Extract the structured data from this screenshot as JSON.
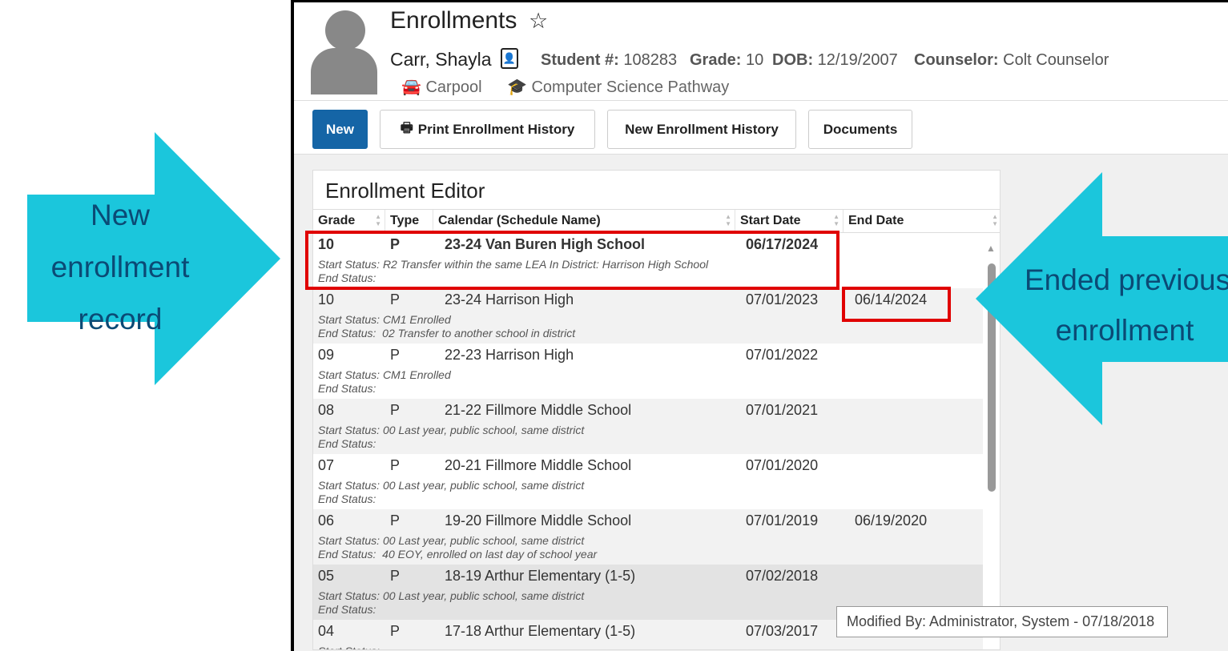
{
  "header": {
    "title": "Enrollments",
    "student_name": "Carr, Shayla",
    "student_num_label": "Student #:",
    "student_num": "108283",
    "grade_label": "Grade:",
    "grade": "10",
    "dob_label": "DOB:",
    "dob": "12/19/2007",
    "counselor_label": "Counselor:",
    "counselor": "Colt Counselor",
    "tags": [
      {
        "label": "Carpool",
        "icon": "car-icon",
        "color": "#2e86de"
      },
      {
        "label": "Computer Science Pathway",
        "icon": "graduate-icon",
        "color": "#6a3fa0"
      }
    ]
  },
  "toolbar": {
    "new": "New",
    "print": "Print Enrollment History",
    "new_history": "New Enrollment History",
    "documents": "Documents"
  },
  "editor": {
    "title": "Enrollment Editor",
    "columns": [
      "Grade",
      "Type",
      "Calendar (Schedule Name)",
      "Start Date",
      "End Date"
    ],
    "start_label": "Start Status:",
    "end_label": "End Status:",
    "rows": [
      {
        "grade": "10",
        "type": "P",
        "calendar": "23-24 Van Buren High School",
        "start": "06/17/2024",
        "end": "",
        "start_status": "R2 Transfer within the same LEA In District: Harrison High School",
        "end_status": ""
      },
      {
        "grade": "10",
        "type": "P",
        "calendar": "23-24 Harrison High",
        "start": "07/01/2023",
        "end": "06/14/2024",
        "start_status": "CM1 Enrolled",
        "end_status": "02 Transfer to another school in district"
      },
      {
        "grade": "09",
        "type": "P",
        "calendar": "22-23 Harrison High",
        "start": "07/01/2022",
        "end": "",
        "start_status": "CM1 Enrolled",
        "end_status": ""
      },
      {
        "grade": "08",
        "type": "P",
        "calendar": "21-22 Fillmore Middle School",
        "start": "07/01/2021",
        "end": "",
        "start_status": "00 Last year, public school, same district",
        "end_status": ""
      },
      {
        "grade": "07",
        "type": "P",
        "calendar": "20-21 Fillmore Middle School",
        "start": "07/01/2020",
        "end": "",
        "start_status": "00 Last year, public school, same district",
        "end_status": ""
      },
      {
        "grade": "06",
        "type": "P",
        "calendar": "19-20 Fillmore Middle School",
        "start": "07/01/2019",
        "end": "06/19/2020",
        "start_status": "00 Last year, public school, same district",
        "end_status": "40 EOY, enrolled on last day of school year"
      },
      {
        "grade": "05",
        "type": "P",
        "calendar": "18-19 Arthur Elementary (1-5)",
        "start": "07/02/2018",
        "end": "",
        "start_status": "00 Last year, public school, same district",
        "end_status": ""
      },
      {
        "grade": "04",
        "type": "P",
        "calendar": "17-18 Arthur Elementary (1-5)",
        "start": "07/03/2017",
        "end": "",
        "start_status": "",
        "end_status": ""
      }
    ]
  },
  "modified": "Modified By: Administrator, System - 07/18/2018",
  "annotations": {
    "left": [
      "New",
      "enrollment",
      "record"
    ],
    "right": [
      "Ended previous",
      "enrollment"
    ],
    "arrow_color": "#1bc6dc",
    "highlight_color": "#e00000"
  }
}
